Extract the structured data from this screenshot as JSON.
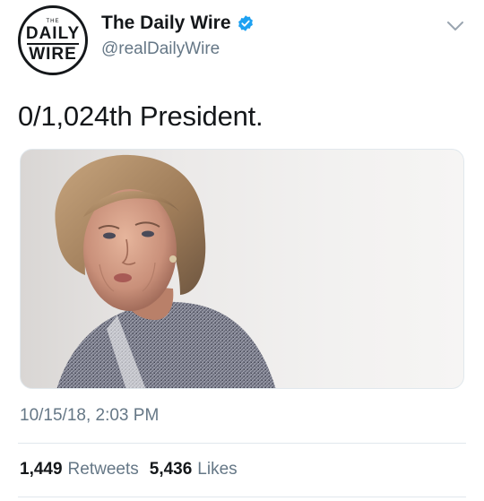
{
  "account": {
    "display_name": "The Daily Wire",
    "handle": "@realDailyWire",
    "avatar_logo": {
      "top": "THE",
      "line1": "DAILY",
      "line2": "WIRE"
    },
    "verified": true
  },
  "tweet": {
    "text": "0/1,024th President.",
    "timestamp": "10/15/18, 2:03 PM"
  },
  "media": {
    "kind": "photo"
  },
  "stats": {
    "retweets_count": "1,449",
    "retweets_label": "Retweets",
    "likes_count": "5,436",
    "likes_label": "Likes"
  },
  "colors": {
    "text_primary": "#14171a",
    "text_secondary": "#657786",
    "verified_blue": "#1da1f2",
    "divider": "#e1e8ed"
  },
  "icons": {
    "verified": "verified-badge-icon",
    "menu": "chevron-down-icon"
  }
}
